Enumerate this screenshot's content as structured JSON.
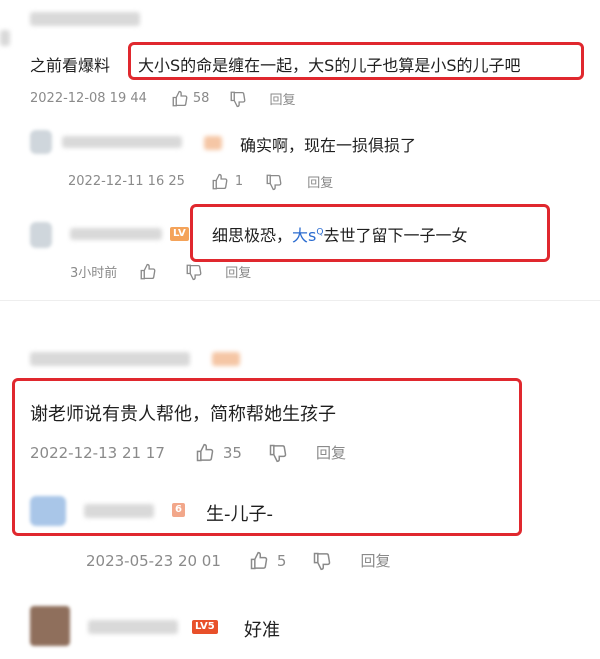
{
  "comments": [
    {
      "prefix": "之前看爆料",
      "highlight": "大小S的命是缠在一起，大S的儿子也算是小S的儿子吧",
      "date": "2022-12-08 19 44",
      "likes": "58",
      "reply_label": "回复"
    },
    {
      "text": "确实啊，现在一损俱损了",
      "date": "2022-12-11 16 25",
      "likes": "1",
      "reply_label": "回复"
    },
    {
      "text_before": "细思极恐，",
      "mention": "大s",
      "mention_sup": "Q",
      "text_after": "去世了留下一子一女",
      "date": "3小时前",
      "reply_label": "回复",
      "badge": "LV"
    },
    {
      "text": "谢老师说有贵人帮他，简称帮她生孩子",
      "date": "2022-12-13 21 17",
      "likes": "35",
      "reply_label": "回复"
    },
    {
      "text": "生-儿子-",
      "date": "2023-05-23 20 01",
      "likes": "5",
      "reply_label": "回复",
      "badge": "6"
    },
    {
      "text": "好准",
      "badge": "LV5"
    }
  ],
  "colors": {
    "highlight_border": "#e0282e",
    "badge": "#f08a24",
    "meta_text": "#8a8a8a",
    "link": "#2b6cd0"
  },
  "icons": [
    "thumbs-up-icon",
    "thumbs-down-icon"
  ]
}
